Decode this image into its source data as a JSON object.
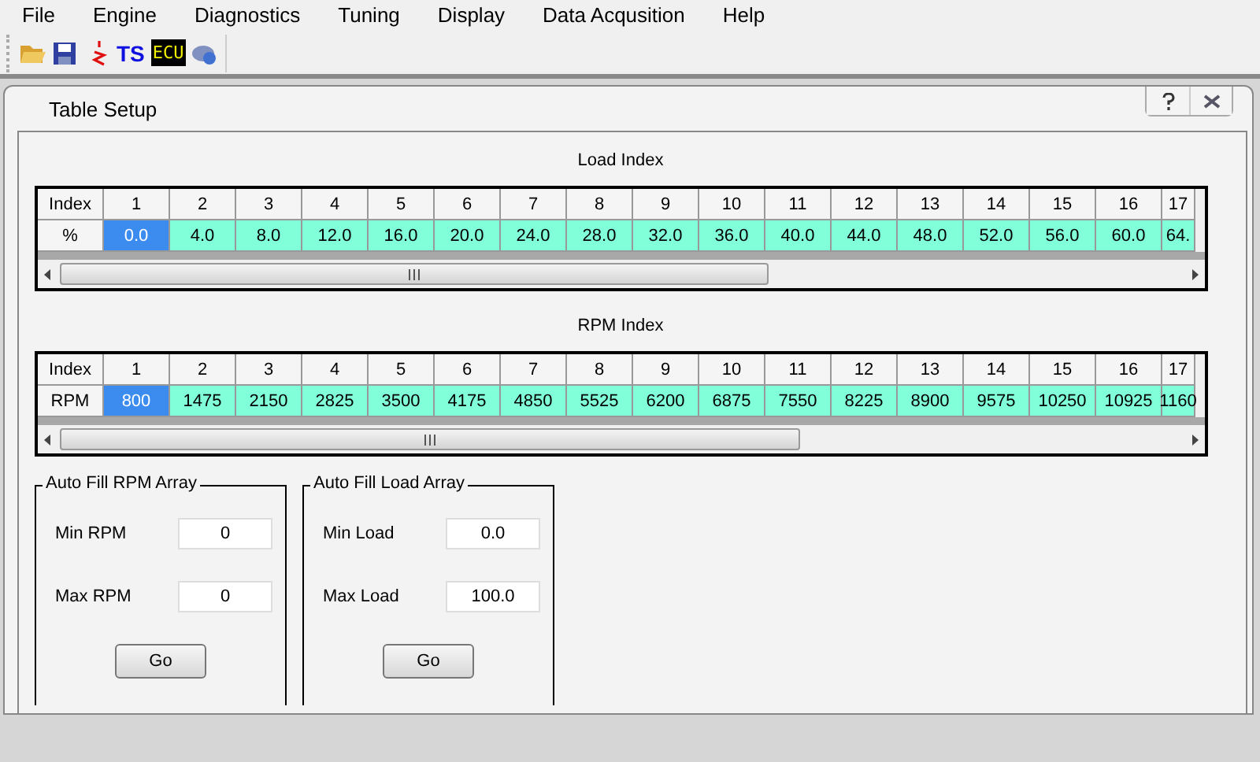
{
  "menu": [
    "File",
    "Engine",
    "Diagnostics",
    "Tuning",
    "Display",
    "Data Acqusition",
    "Help"
  ],
  "toolbar": {
    "ts_label": "TS",
    "ecu_label": "ECU"
  },
  "dialog": {
    "title": "Table Setup"
  },
  "tables": [
    {
      "title": "Load Index",
      "row_label": "%",
      "header_label": "Index",
      "indexes": [
        "1",
        "2",
        "3",
        "4",
        "5",
        "6",
        "7",
        "8",
        "9",
        "10",
        "11",
        "12",
        "13",
        "14",
        "15",
        "16",
        "17"
      ],
      "cells": [
        {
          "value": "0.0",
          "selected": true
        },
        {
          "value": "4.0",
          "selected": false
        },
        {
          "value": "8.0",
          "selected": false
        },
        {
          "value": "12.0",
          "selected": false
        },
        {
          "value": "16.0",
          "selected": false
        },
        {
          "value": "20.0",
          "selected": false
        },
        {
          "value": "24.0",
          "selected": false
        },
        {
          "value": "28.0",
          "selected": false
        },
        {
          "value": "32.0",
          "selected": false
        },
        {
          "value": "36.0",
          "selected": false
        },
        {
          "value": "40.0",
          "selected": false
        },
        {
          "value": "44.0",
          "selected": false
        },
        {
          "value": "48.0",
          "selected": false
        },
        {
          "value": "52.0",
          "selected": false
        },
        {
          "value": "56.0",
          "selected": false
        },
        {
          "value": "60.0",
          "selected": false
        },
        {
          "value": "64.",
          "selected": false
        }
      ]
    },
    {
      "title": "RPM Index",
      "row_label": "RPM",
      "header_label": "Index",
      "indexes": [
        "1",
        "2",
        "3",
        "4",
        "5",
        "6",
        "7",
        "8",
        "9",
        "10",
        "11",
        "12",
        "13",
        "14",
        "15",
        "16",
        "17"
      ],
      "cells": [
        {
          "value": "800",
          "selected": true
        },
        {
          "value": "1475",
          "selected": false
        },
        {
          "value": "2150",
          "selected": false
        },
        {
          "value": "2825",
          "selected": false
        },
        {
          "value": "3500",
          "selected": false
        },
        {
          "value": "4175",
          "selected": false
        },
        {
          "value": "4850",
          "selected": false
        },
        {
          "value": "5525",
          "selected": false
        },
        {
          "value": "6200",
          "selected": false
        },
        {
          "value": "6875",
          "selected": false
        },
        {
          "value": "7550",
          "selected": false
        },
        {
          "value": "8225",
          "selected": false
        },
        {
          "value": "8900",
          "selected": false
        },
        {
          "value": "9575",
          "selected": false
        },
        {
          "value": "10250",
          "selected": false
        },
        {
          "value": "10925",
          "selected": false
        },
        {
          "value": "1160",
          "selected": false
        }
      ]
    }
  ],
  "groups": [
    {
      "title": "Auto Fill RPM Array",
      "fields": [
        {
          "label": "Min RPM",
          "value": "0"
        },
        {
          "label": "Max RPM",
          "value": "0"
        }
      ],
      "button": "Go"
    },
    {
      "title": "Auto Fill Load Array",
      "fields": [
        {
          "label": "Min Load",
          "value": "0.0"
        },
        {
          "label": "Max Load",
          "value": "100.0"
        }
      ],
      "button": "Go"
    }
  ]
}
